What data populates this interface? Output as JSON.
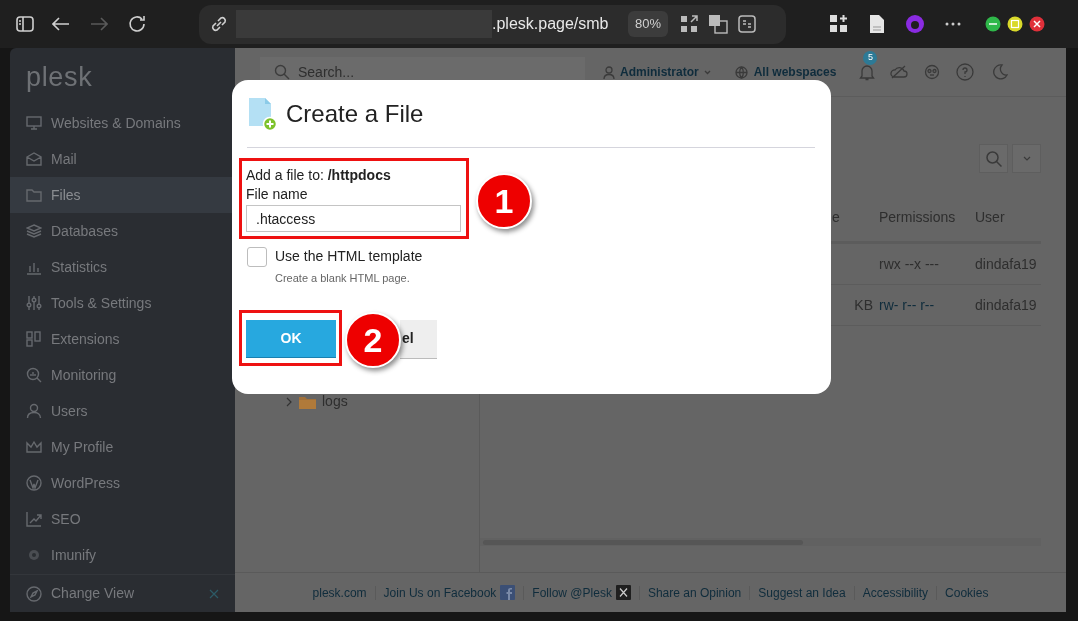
{
  "browser": {
    "url": ".plesk.page/smb",
    "zoom": "80%"
  },
  "sidebar": {
    "logo": "plesk",
    "items": [
      {
        "label": "Websites & Domains",
        "selected": false
      },
      {
        "label": "Mail",
        "selected": false
      },
      {
        "label": "Files",
        "selected": true
      },
      {
        "label": "Databases",
        "selected": false
      },
      {
        "label": "Statistics",
        "selected": false
      },
      {
        "label": "Tools & Settings",
        "selected": false
      },
      {
        "label": "Extensions",
        "selected": false
      },
      {
        "label": "Monitoring",
        "selected": false
      },
      {
        "label": "Users",
        "selected": false
      },
      {
        "label": "My Profile",
        "selected": false
      },
      {
        "label": "WordPress",
        "selected": false
      },
      {
        "label": "SEO",
        "selected": false
      },
      {
        "label": "Imunify",
        "selected": false
      }
    ],
    "change_view": "Change View"
  },
  "header": {
    "search_placeholder": "Search...",
    "user": "Administrator",
    "webspaces": "All webspaces",
    "notifications": "5"
  },
  "file_tree": [
    {
      "label": "logs",
      "expanded": false
    }
  ],
  "table": {
    "columns": [
      "e",
      "Permissions",
      "User"
    ],
    "rows": [
      {
        "cells": [
          "",
          "rwx --x ---",
          "dindafa19"
        ],
        "permissions_link": false
      },
      {
        "cells": [
          "KB",
          "rw- r-- r--",
          "dindafa19"
        ],
        "permissions_link": true
      }
    ]
  },
  "footer": [
    {
      "label": "plesk.com",
      "kind": "plain"
    },
    {
      "label": "Join Us on Facebook",
      "kind": "facebook"
    },
    {
      "label": "Follow @Plesk",
      "kind": "x"
    },
    {
      "label": "Share an Opinion",
      "kind": "plain"
    },
    {
      "label": "Suggest an Idea",
      "kind": "plain"
    },
    {
      "label": "Accessibility",
      "kind": "plain"
    },
    {
      "label": "Cookies",
      "kind": "plain"
    }
  ],
  "dialog": {
    "title": "Create a File",
    "target": "Add a file to: **/httpdocs**",
    "field_label": "File name",
    "value": ".htaccess",
    "template": {
      "label": "Use the HTML template",
      "hint": "Create a blank HTML page.",
      "checked": false
    },
    "buttons": [
      {
        "label": "OK",
        "kind": "primary"
      },
      {
        "label": "el",
        "kind": "secondary"
      }
    ]
  },
  "annotations": [
    {
      "number": "1"
    },
    {
      "number": "2"
    }
  ]
}
